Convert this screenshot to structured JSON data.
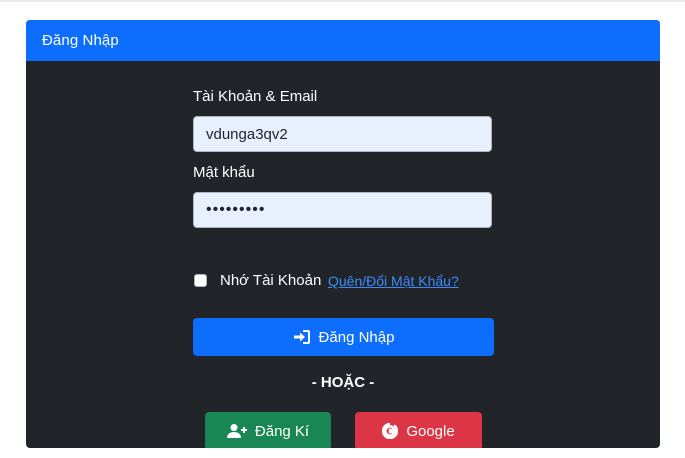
{
  "header": {
    "title": "Đăng Nhập"
  },
  "form": {
    "account_label": "Tài Khoản & Email",
    "account_value": "vdunga3qv2",
    "password_label": "Mật khẩu",
    "password_value": "•••••••••",
    "remember_label": "Nhớ Tài Khoản",
    "remember_checked": false,
    "forgot_link": "Quên/Đổi Mật Khẩu?",
    "login_button": "Đăng Nhập",
    "or_text": "- HOẶC -",
    "register_button": "Đăng Kí",
    "google_button": "Google"
  },
  "icons": {
    "login": "sign-in-icon",
    "register": "user-plus-icon",
    "google": "google-icon"
  },
  "colors": {
    "primary": "#0d6efd",
    "success": "#198754",
    "danger": "#dc3545",
    "dark": "#212529",
    "link": "#3d8bfd"
  }
}
